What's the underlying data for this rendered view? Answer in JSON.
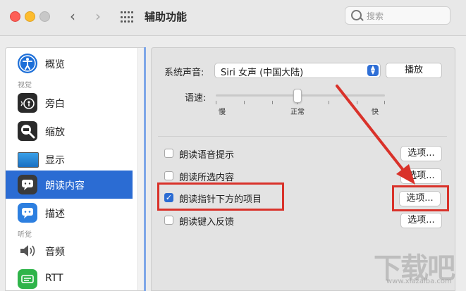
{
  "window": {
    "title": "辅助功能",
    "search_placeholder": "搜索"
  },
  "sidebar": {
    "items": [
      {
        "label": "概览",
        "icon": "accessibility-icon"
      },
      {
        "section": "视觉"
      },
      {
        "label": "旁白",
        "icon": "voiceover-icon"
      },
      {
        "label": "缩放",
        "icon": "zoom-icon"
      },
      {
        "label": "显示",
        "icon": "display-icon"
      },
      {
        "label": "朗读内容",
        "icon": "speech-icon",
        "selected": true
      },
      {
        "label": "描述",
        "icon": "descriptions-icon"
      },
      {
        "section": "听觉"
      },
      {
        "label": "音频",
        "icon": "audio-icon"
      },
      {
        "label": "RTT",
        "icon": "rtt-icon"
      }
    ]
  },
  "content": {
    "voice_label": "系统声音:",
    "voice_value": "Siri 女声 (中国大陆)",
    "play_button": "播放",
    "rate_label": "语速:",
    "rate_slow": "慢",
    "rate_normal": "正常",
    "rate_fast": "快",
    "rate_value_fraction": 0.5,
    "options": [
      {
        "label": "朗读语音提示",
        "checked": false,
        "button": "选项..."
      },
      {
        "label": "朗读所选内容",
        "checked": false,
        "button": "选项..."
      },
      {
        "label": "朗读指针下方的项目",
        "checked": true,
        "button": "选项..."
      },
      {
        "label": "朗读键入反馈",
        "checked": false,
        "button": "选项..."
      }
    ]
  },
  "colors": {
    "accent": "#2b6cd3",
    "annotation_red": "#d9322a"
  },
  "watermark": {
    "text": "下载吧",
    "url": "www.xiazaiba.com"
  }
}
